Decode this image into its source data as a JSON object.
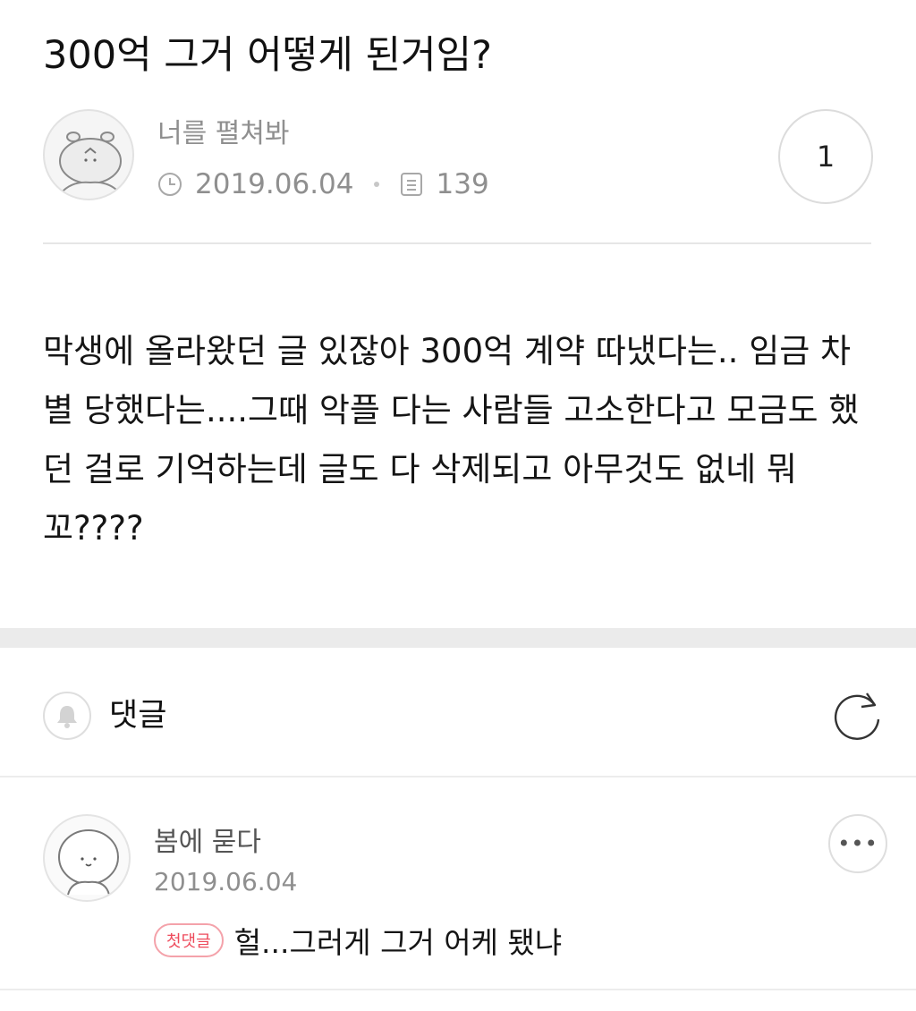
{
  "post": {
    "title": "300억 그거 어떻게 된거임?",
    "author": "너를 펼쳐봐",
    "date": "2019.06.04",
    "views": "139",
    "comment_count": "1",
    "body": "막생에 올라왔던 글 있잖아 300억 계약 따냈다는.. 임금 차별 당했다는....그때 악플 다는 사람들 고소한다고 모금도 했던 걸로 기억하는데 글도 다 삭제되고 아무것도 없네 뭐꼬????"
  },
  "comments_section": {
    "label": "댓글"
  },
  "comments": [
    {
      "author": "봄에 묻다",
      "date": "2019.06.04",
      "badge": "첫댓글",
      "text": "헐...그러게 그거 어케 됐냐",
      "more_label": "•••"
    }
  ],
  "icons": {
    "clock": "clock-icon",
    "views": "document-icon",
    "bell": "bell-icon",
    "refresh": "refresh-icon",
    "more": "more-icon"
  },
  "colors": {
    "badge_accent": "#ee4b5c",
    "meta_gray": "#8f8f8f",
    "divider": "#e6e6e6",
    "band": "#ebebeb"
  }
}
